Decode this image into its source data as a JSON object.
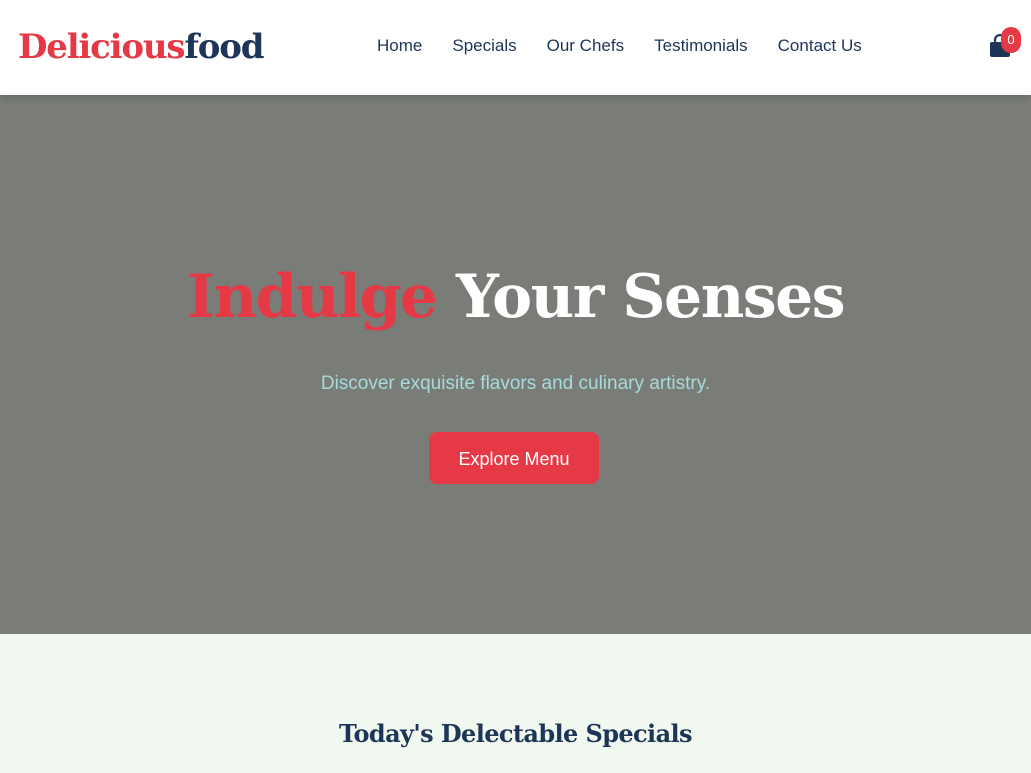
{
  "colors": {
    "accent": "#e63946",
    "navy": "#1d3557",
    "hero_bg": "#7a7d77",
    "subtitle": "#a8dadc",
    "section_bg": "#f1f8ef"
  },
  "header": {
    "logo": {
      "part_a": "Delicious",
      "part_b": "food"
    },
    "nav": [
      "Home",
      "Specials",
      "Our Chefs",
      "Testimonials",
      "Contact Us"
    ],
    "cart": {
      "icon": "shopping-bag-icon",
      "count": "0"
    }
  },
  "hero": {
    "title_accent": "Indulge",
    "title_rest": "Your Senses",
    "subtitle": "Discover exquisite flavors and culinary artistry.",
    "cta_label": "Explore Menu"
  },
  "specials": {
    "title": "Today's Delectable Specials"
  }
}
